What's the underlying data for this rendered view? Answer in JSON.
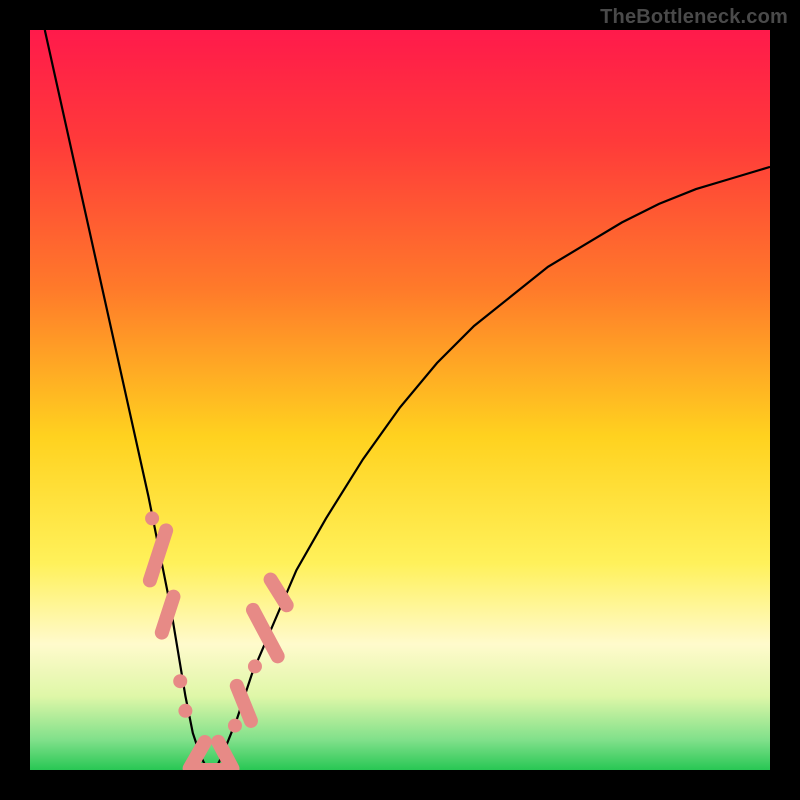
{
  "watermark": {
    "text": "TheBottleneck.com"
  },
  "colors": {
    "frame": "#000000",
    "gradient_stops": [
      {
        "offset": 0.0,
        "color": "#ff1a4b"
      },
      {
        "offset": 0.15,
        "color": "#ff3a3a"
      },
      {
        "offset": 0.35,
        "color": "#ff7a2a"
      },
      {
        "offset": 0.55,
        "color": "#ffd21f"
      },
      {
        "offset": 0.72,
        "color": "#fff15a"
      },
      {
        "offset": 0.83,
        "color": "#fffacc"
      },
      {
        "offset": 0.9,
        "color": "#dff7a8"
      },
      {
        "offset": 0.96,
        "color": "#7fe08a"
      },
      {
        "offset": 1.0,
        "color": "#28c754"
      }
    ],
    "curve": "#000000",
    "marker_fill": "#e78a86",
    "marker_stroke": "#e78a86"
  },
  "chart_data": {
    "type": "line",
    "title": "",
    "xlabel": "",
    "ylabel": "",
    "xlim": [
      0,
      100
    ],
    "ylim": [
      0,
      100
    ],
    "grid": false,
    "legend": false,
    "series": [
      {
        "name": "curve",
        "x": [
          2,
          4,
          6,
          8,
          10,
          12,
          14,
          16,
          17,
          18,
          19,
          20,
          21,
          22,
          23,
          24,
          25,
          26,
          28,
          30,
          33,
          36,
          40,
          45,
          50,
          55,
          60,
          65,
          70,
          75,
          80,
          85,
          90,
          95,
          100
        ],
        "y": [
          100,
          91,
          82,
          73,
          64,
          55,
          46,
          37,
          32,
          27,
          22,
          16,
          10,
          5,
          2,
          0,
          0,
          2,
          7,
          13,
          20,
          27,
          34,
          42,
          49,
          55,
          60,
          64,
          68,
          71,
          74,
          76.5,
          78.5,
          80,
          81.5
        ]
      }
    ],
    "markers": [
      {
        "kind": "dot",
        "x": 16.5,
        "y": 34
      },
      {
        "kind": "dot",
        "x": 20.3,
        "y": 12
      },
      {
        "kind": "dot",
        "x": 21.0,
        "y": 8
      },
      {
        "kind": "dot",
        "x": 27.7,
        "y": 6
      },
      {
        "kind": "dot",
        "x": 30.4,
        "y": 14
      },
      {
        "kind": "lozenge",
        "x": 17.3,
        "y": 29,
        "len": 9,
        "angle": -72
      },
      {
        "kind": "lozenge",
        "x": 18.6,
        "y": 21,
        "len": 7,
        "angle": -72
      },
      {
        "kind": "lozenge",
        "x": 22.6,
        "y": 2,
        "len": 6,
        "angle": -60
      },
      {
        "kind": "lozenge",
        "x": 24.3,
        "y": 0,
        "len": 5,
        "angle": 0
      },
      {
        "kind": "lozenge",
        "x": 26.4,
        "y": 2,
        "len": 6,
        "angle": 62
      },
      {
        "kind": "lozenge",
        "x": 28.9,
        "y": 9,
        "len": 7,
        "angle": 68
      },
      {
        "kind": "lozenge",
        "x": 31.8,
        "y": 18.5,
        "len": 9,
        "angle": 62
      },
      {
        "kind": "lozenge",
        "x": 33.6,
        "y": 24,
        "len": 6,
        "angle": 58
      }
    ]
  }
}
